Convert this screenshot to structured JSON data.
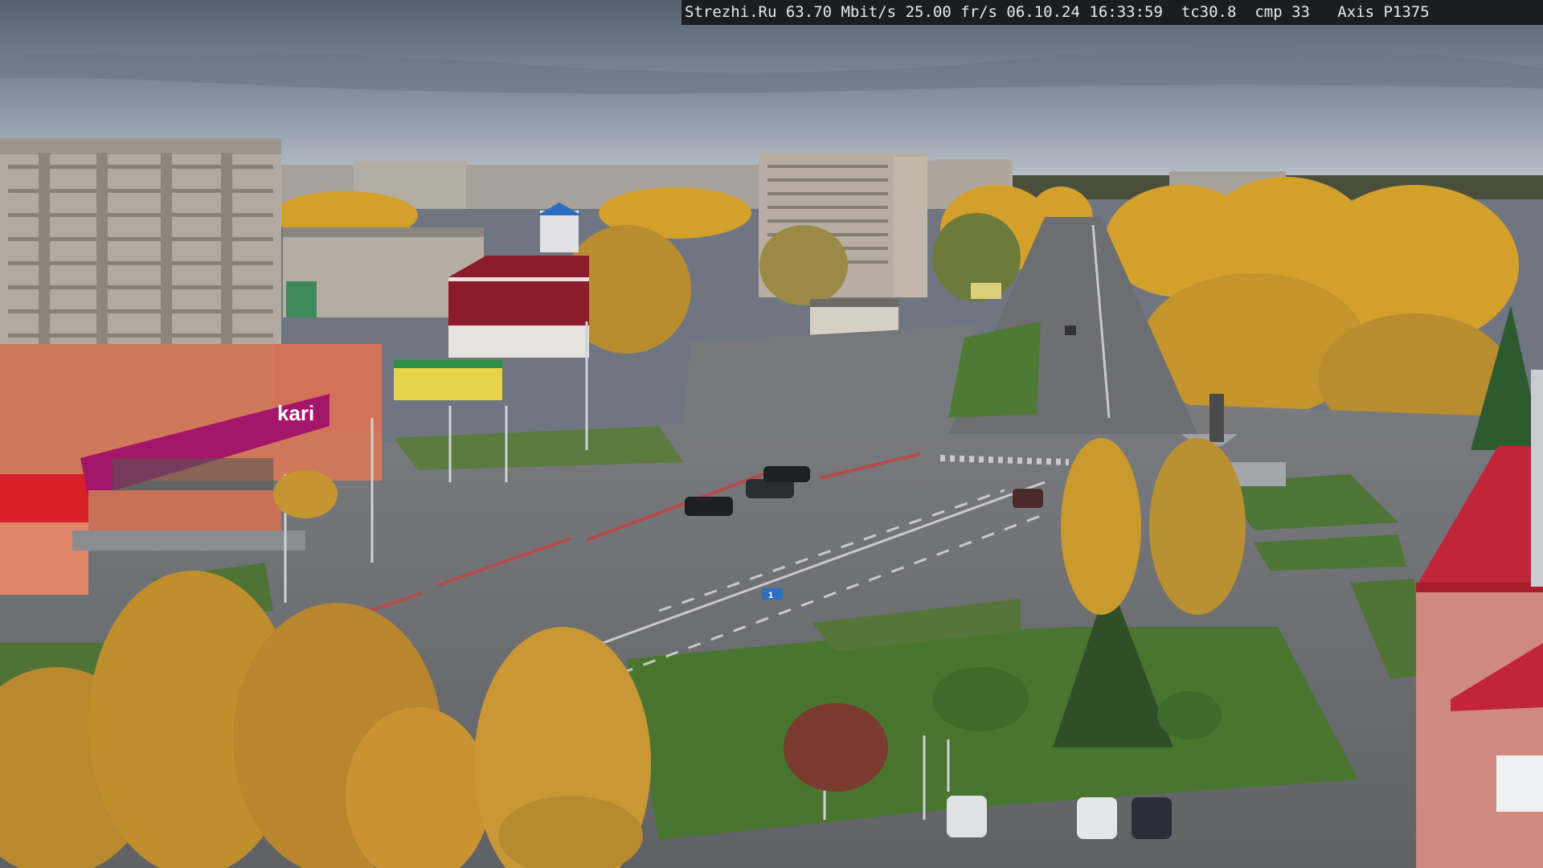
{
  "overlay": {
    "site": "Strezhi.Ru",
    "bitrate": "63.70 Mbit/s",
    "framerate": "25.00 fr/s",
    "date": "06.10.24",
    "time": "16:33:59",
    "tc": "tc30.8",
    "cmp": "cmp 33",
    "camera": "Axis P1375"
  },
  "signs": {
    "store_brand": "kari",
    "road_sign": "1"
  },
  "colors": {
    "sky_top": "#5d6877",
    "sky_bottom": "#b9c2cd",
    "foliage_gold": "#d6a12a",
    "grass": "#4f7a33",
    "road": "#6e7075",
    "store_magenta": "#a4166a",
    "red_roof": "#c2243a"
  }
}
